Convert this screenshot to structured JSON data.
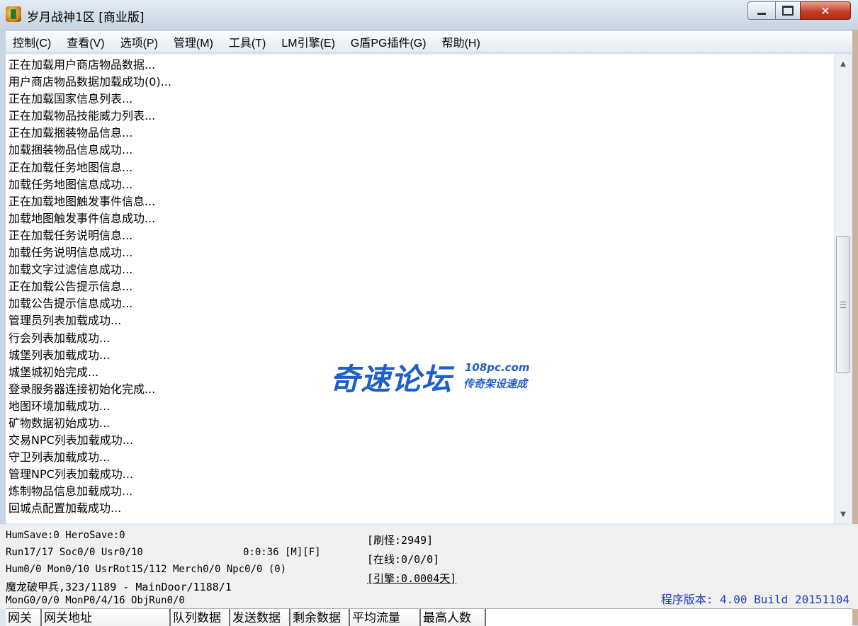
{
  "window": {
    "title": "岁月战神1区 [商业版]",
    "minimize_glyph": "",
    "maximize_glyph": "",
    "close_glyph": "✕"
  },
  "menu": [
    "控制(C)",
    "查看(V)",
    "选项(P)",
    "管理(M)",
    "工具(T)",
    "LM引擎(E)",
    "G盾PG插件(G)",
    "帮助(H)"
  ],
  "log_lines": [
    "正在加载用户商店物品数据...",
    "用户商店物品数据加载成功(0)...",
    "正在加载国家信息列表...",
    "正在加载物品技能威力列表...",
    "正在加载捆装物品信息...",
    "加载捆装物品信息成功...",
    "正在加载任务地图信息...",
    "加载任务地图信息成功...",
    "正在加载地图触发事件信息...",
    "加载地图触发事件信息成功...",
    "正在加载任务说明信息...",
    "加载任务说明信息成功...",
    "加载文字过滤信息成功...",
    "正在加载公告提示信息...",
    "加载公告提示信息成功...",
    "管理员列表加载成功...",
    "行会列表加载成功...",
    "城堡列表加载成功...",
    "城堡城初始完成...",
    "登录服务器连接初始化完成...",
    "地图环境加载成功...",
    "矿物数据初始成功...",
    "交易NPC列表加载成功...",
    "守卫列表加载成功...",
    "管理NPC列表加载成功...",
    "炼制物品信息加载成功...",
    "回城点配置加载成功..."
  ],
  "watermark": {
    "main": "奇速论坛",
    "url": "108pc.com",
    "sub": "传奇架设速成"
  },
  "status": {
    "line1": "HumSave:0 HeroSave:0",
    "line2": "Run17/17 Soc0/0 Usr0/10",
    "clock": "0:0:36 [M][F]",
    "line3": "Hum0/0 Mon0/10 UsrRot15/112 Merch0/0 Npc0/0 (0)",
    "line4": "魔龙破甲兵,323/1189 - MainDoor/1188/1",
    "line5": "MonG0/0/0 MonP0/4/16 ObjRun0/0",
    "refresh": "[刷怪:2949]",
    "online": "[在线:0/0/0]",
    "engine": "[引擎:0.0004天]",
    "version": "程序版本: 4.00 Build 20151104"
  },
  "table_headers": [
    "网关",
    "网关地址",
    "队列数据",
    "发送数据",
    "剩余数据",
    "平均流量",
    "最高人数"
  ]
}
